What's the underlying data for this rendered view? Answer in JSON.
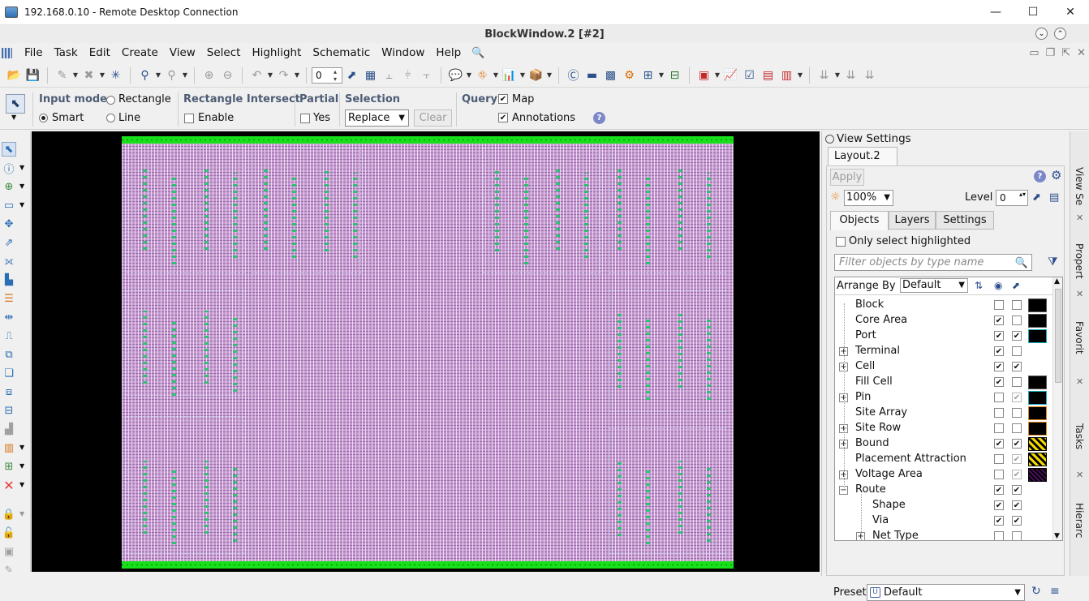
{
  "rdp": {
    "title": "192.168.0.10 - Remote Desktop Connection",
    "min": "—",
    "max": "☐",
    "close": "✕"
  },
  "app": {
    "title": "BlockWindow.2 [#2]"
  },
  "menu": [
    "File",
    "Task",
    "Edit",
    "Create",
    "View",
    "Select",
    "Highlight",
    "Schematic",
    "Window",
    "Help"
  ],
  "toolbar": {
    "spin_value": "0"
  },
  "options": {
    "input_mode_label": "Input mode",
    "rectangle": "Rectangle",
    "smart": "Smart",
    "line": "Line",
    "rect_intersect_label": "Rectangle Intersect",
    "enable": "Enable",
    "partial_label": "Partial",
    "yes": "Yes",
    "selection_label": "Selection",
    "selection_value": "Replace",
    "clear": "Clear",
    "query_label": "Query",
    "map": "Map",
    "annotations": "Annotations",
    "help": "?"
  },
  "view_settings": {
    "title": "View Settings",
    "layout_tab": "Layout.2",
    "apply": "Apply",
    "zoom": "100%",
    "level_label": "Level",
    "level_value": "0",
    "tabs": [
      "Objects",
      "Layers",
      "Settings"
    ],
    "only_select_highlighted": "Only select highlighted",
    "filter_placeholder": "Filter objects by type name",
    "arrange_by": "Arrange By",
    "arrange_value": "Default",
    "preset_label": "Preset",
    "preset_value": "Default",
    "items": [
      {
        "label": "Block",
        "vis": "",
        "sel": "",
        "swatch": "#000000",
        "border": "#555555"
      },
      {
        "label": "Core Area",
        "vis": "✔",
        "sel": "",
        "swatch": "#000000",
        "border": "#555555"
      },
      {
        "label": "Port",
        "vis": "✔",
        "sel": "✔",
        "swatch": "#000000",
        "border": "#18a9c4"
      },
      {
        "label": "Terminal",
        "vis": "✔",
        "sel": "",
        "swatch": "",
        "border": ""
      },
      {
        "label": "Cell",
        "vis": "✔",
        "sel": "✔",
        "swatch": "",
        "border": ""
      },
      {
        "label": "Fill Cell",
        "vis": "✔",
        "sel": "",
        "swatch": "#000000",
        "border": "#555555"
      },
      {
        "label": "Pin",
        "vis": "",
        "sel": "✔",
        "swatch": "#000000",
        "border": "#18a9c4"
      },
      {
        "label": "Site Array",
        "vis": "",
        "sel": "",
        "swatch": "#000000",
        "border": "#d8861b"
      },
      {
        "label": "Site Row",
        "vis": "",
        "sel": "",
        "swatch": "#000000",
        "border": "#d8861b"
      },
      {
        "label": "Bound",
        "vis": "✔",
        "sel": "✔",
        "swatch": "#f2d600",
        "border": "#000000"
      },
      {
        "label": "Placement Attraction",
        "vis": "",
        "sel": "✔",
        "swatch": "#f2d600",
        "border": "#000000"
      },
      {
        "label": "Voltage Area",
        "vis": "",
        "sel": "✔",
        "swatch": "#4a0d5a",
        "border": "#000000"
      },
      {
        "label": "Route",
        "vis": "✔",
        "sel": "✔",
        "swatch": "",
        "border": ""
      },
      {
        "label": "Shape",
        "vis": "✔",
        "sel": "✔",
        "swatch": "",
        "border": ""
      },
      {
        "label": "Via",
        "vis": "✔",
        "sel": "✔",
        "swatch": "",
        "border": ""
      },
      {
        "label": "Net Type",
        "vis": "",
        "sel": "",
        "swatch": "",
        "border": ""
      }
    ]
  },
  "dock": [
    "View Se",
    "Propert",
    "Favorit",
    "Tasks",
    "Hierarc"
  ]
}
